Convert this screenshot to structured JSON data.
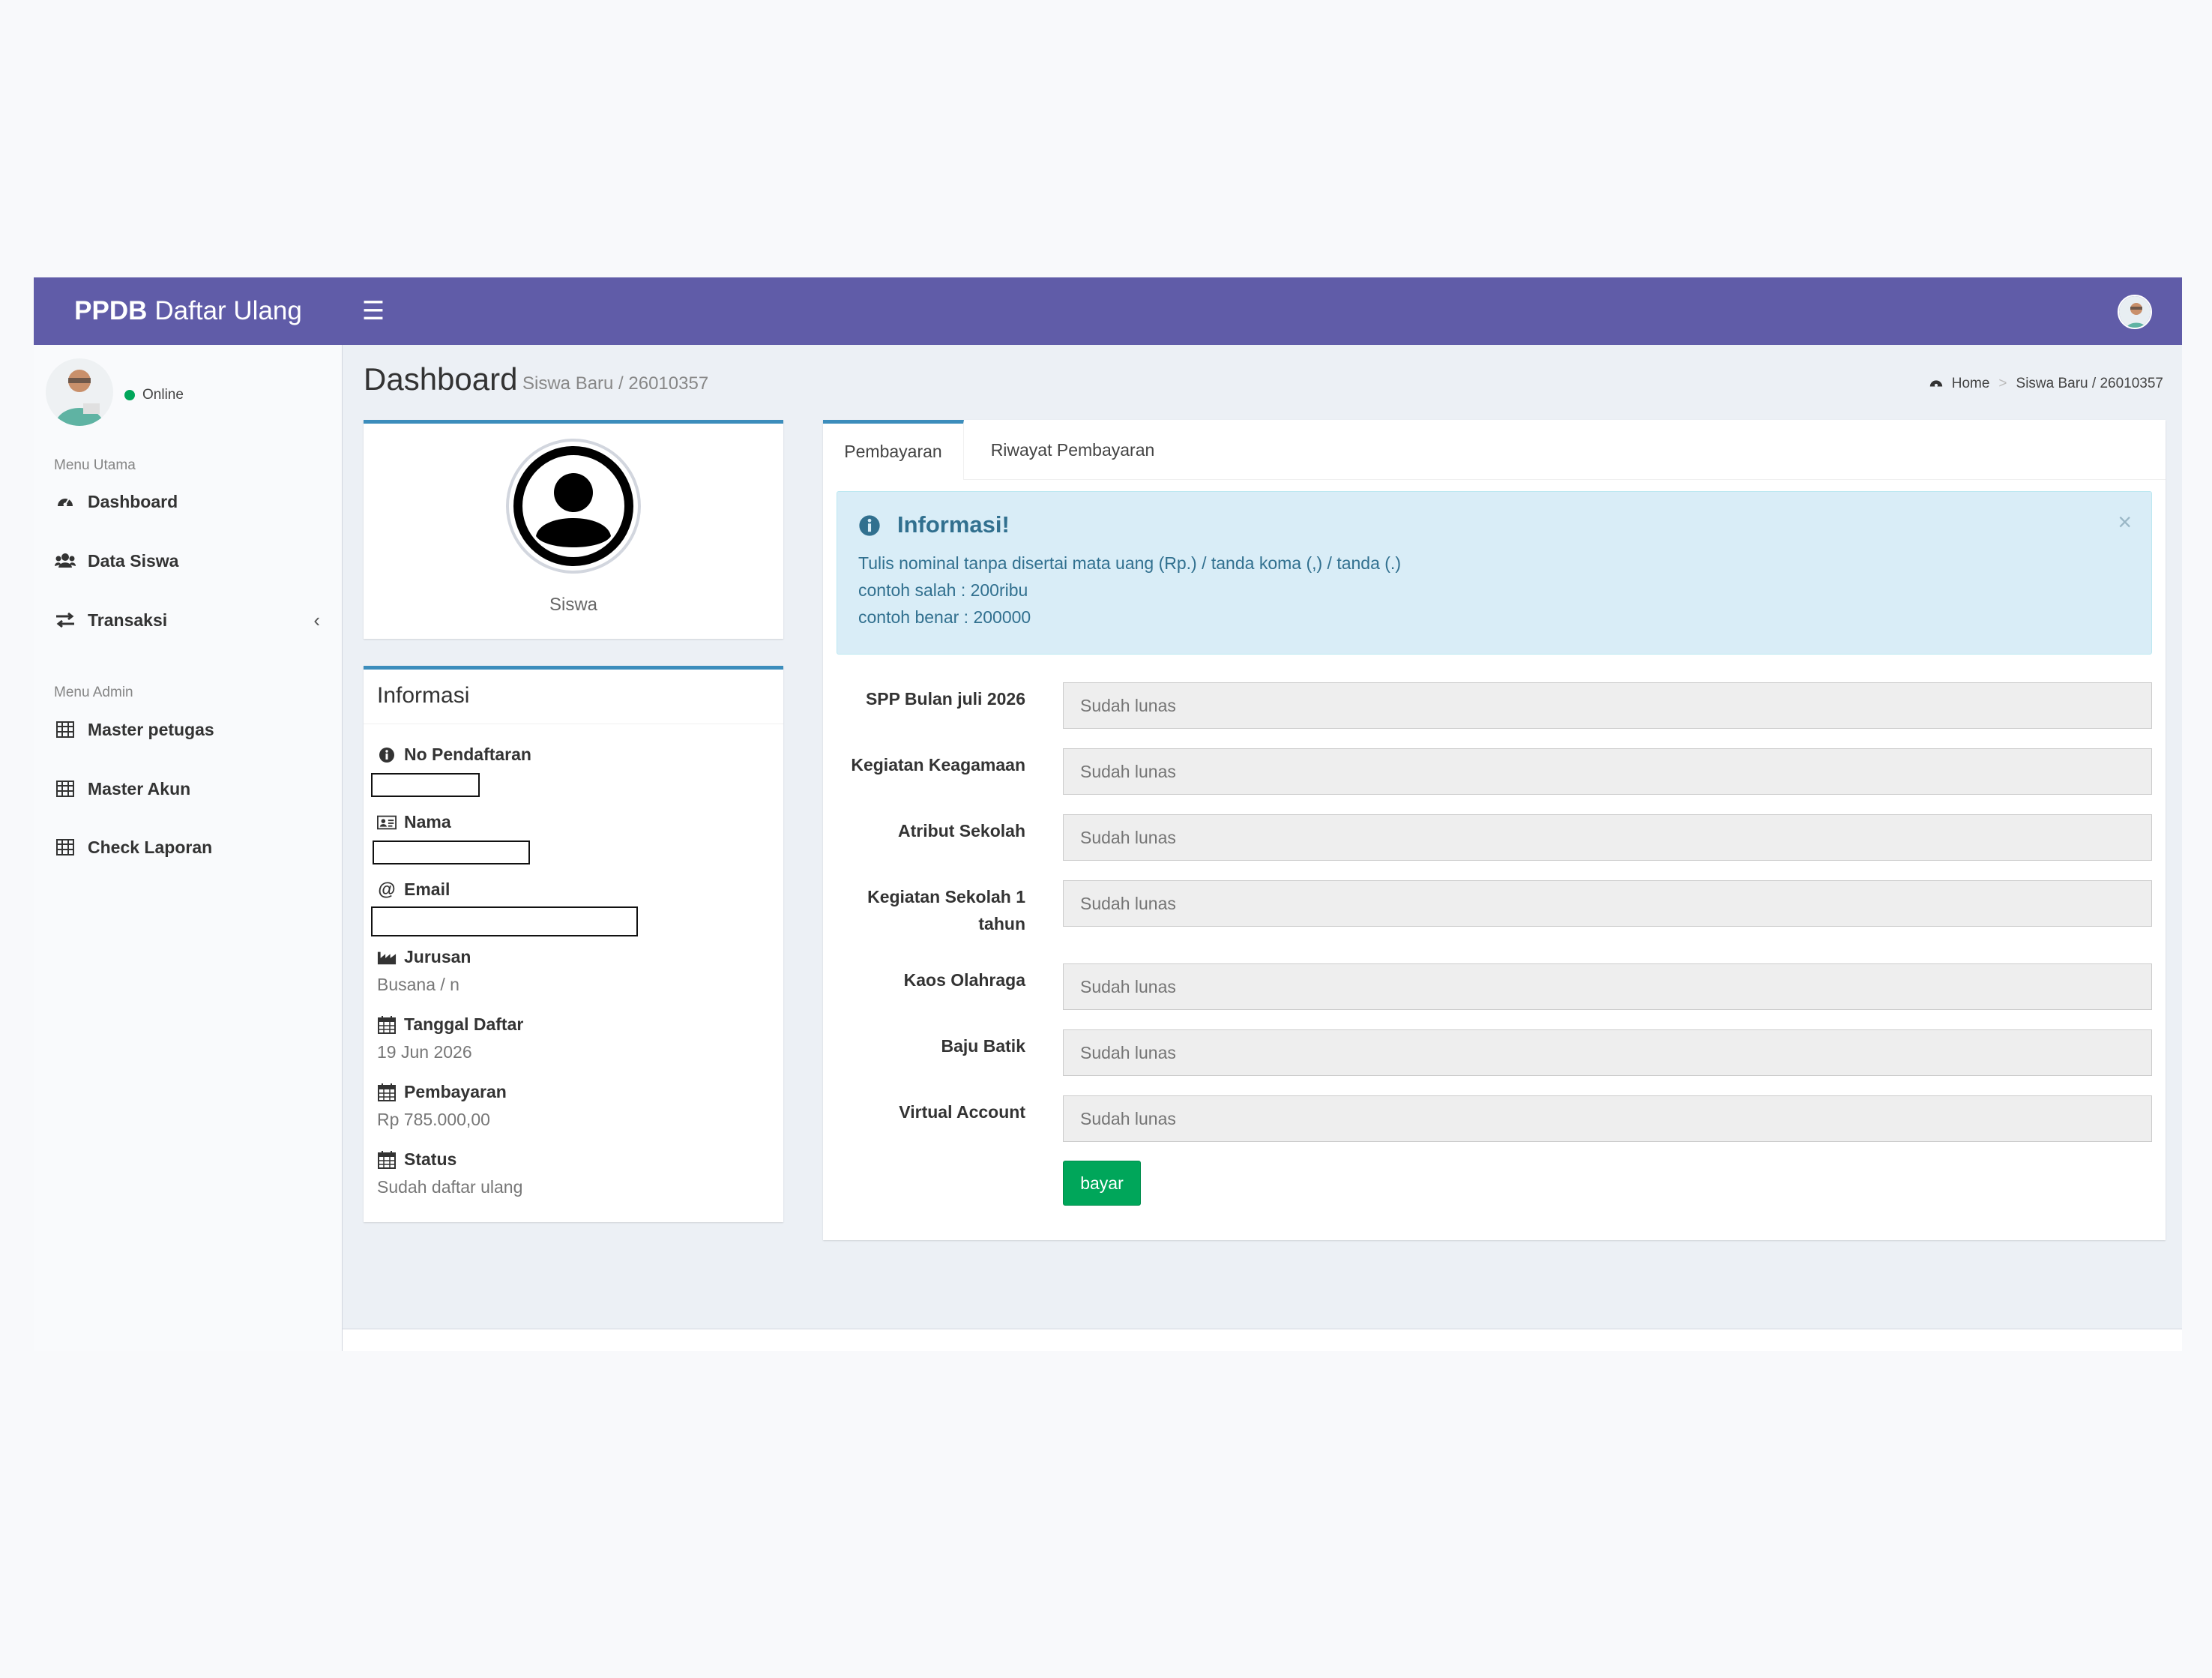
{
  "app": {
    "logo_bold": "PPDB",
    "logo_rest": "Daftar Ulang",
    "toggle_glyph": "☰"
  },
  "sidebar": {
    "status": "Online",
    "menu_utama": "Menu Utama",
    "menu_admin": "Menu Admin",
    "items": [
      {
        "label": "Dashboard",
        "icon": "dashboard-icon"
      },
      {
        "label": "Data Siswa",
        "icon": "users-icon"
      },
      {
        "label": "Transaksi",
        "icon": "exchange-icon"
      },
      {
        "label": "Master petugas",
        "icon": "table-icon"
      },
      {
        "label": "Master Akun",
        "icon": "table-icon"
      },
      {
        "label": "Check Laporan",
        "icon": "table-icon"
      }
    ],
    "caret": "‹"
  },
  "page": {
    "title": "Dashboard",
    "subtitle": "Siswa Baru / 26010357",
    "breadcrumb_home": "Home",
    "breadcrumb_sep": ">",
    "breadcrumb_current": "Siswa Baru / 26010357"
  },
  "profile": {
    "name": "Siswa"
  },
  "info": {
    "title": "Informasi",
    "no_pendaftaran_label": "No Pendaftaran",
    "nama_label": "Nama",
    "email_label": "Email",
    "jurusan_label": "Jurusan",
    "jurusan_value": "Busana / n",
    "tanggal_label": "Tanggal Daftar",
    "tanggal_value": "19 Jun 2026",
    "pembayaran_label": "Pembayaran",
    "pembayaran_value": "Rp 785.000,00",
    "status_label": "Status",
    "status_value": "Sudah daftar ulang"
  },
  "tabs": [
    "Pembayaran",
    "Riwayat Pembayaran"
  ],
  "alert": {
    "title": "Informasi!",
    "close": "×",
    "line1": "Tulis nominal tanpa disertai mata uang (Rp.) / tanda koma (,) / tanda (.)",
    "line2": "contoh salah : 200ribu",
    "line3": "contoh benar : 200000"
  },
  "form": {
    "fields": [
      {
        "label": "SPP Bulan juli 2026",
        "placeholder": "Sudah lunas"
      },
      {
        "label": "Kegiatan Keagamaan",
        "placeholder": "Sudah lunas"
      },
      {
        "label": "Atribut Sekolah",
        "placeholder": "Sudah lunas"
      },
      {
        "label": "Kegiatan Sekolah 1 tahun",
        "placeholder": "Sudah lunas"
      },
      {
        "label": "Kaos Olahraga",
        "placeholder": "Sudah lunas"
      },
      {
        "label": "Baju Batik",
        "placeholder": "Sudah lunas"
      },
      {
        "label": "Virtual Account",
        "placeholder": "Sudah lunas"
      }
    ],
    "submit": "bayar"
  },
  "colors": {
    "header": "#605ca8",
    "accent": "#3c8dbc",
    "success": "#00a65a",
    "alert_bg": "#d9edf7"
  }
}
